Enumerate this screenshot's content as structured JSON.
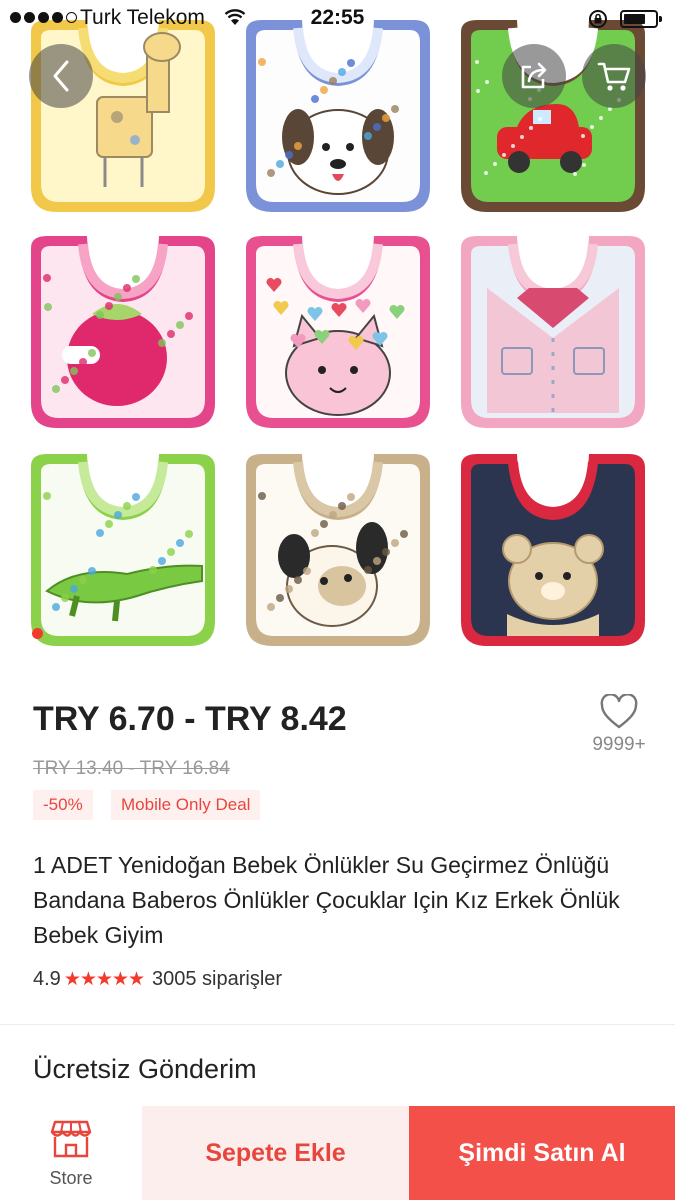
{
  "status_bar": {
    "carrier": "Turk Telekom",
    "time": "22:55"
  },
  "product": {
    "price_range": "TRY 6.70 - TRY 8.42",
    "original_price_range": "TRY 13.40 - TRY 16.84",
    "discount_badge": "-50%",
    "deal_badge": "Mobile Only Deal",
    "title": "1 ADET Yenidoğan Bebek Önlükler Su Geçirmez Önlüğü Bandana Baberos Önlükler Çocuklar Için Kız Erkek Önlük Bebek Giyim",
    "rating": "4.9",
    "stars": "★★★★★",
    "orders": "3005 siparişler",
    "wishlist_count": "9999+"
  },
  "shipping": {
    "label": "Ücretsiz Gönderim"
  },
  "bottom_bar": {
    "store_label": "Store",
    "add_to_cart_label": "Sepete Ekle",
    "buy_now_label": "Şimdi Satın Al"
  },
  "icons": {
    "back": "chevron-left-icon",
    "share": "share-icon",
    "cart": "shopping-cart-icon",
    "wishlist": "heart-icon",
    "store": "store-icon"
  },
  "colors": {
    "accent": "#f23a2e",
    "buy_button": "#f4504a",
    "cart_button_bg": "#fdeeee",
    "badge_bg": "#fff0f0"
  }
}
